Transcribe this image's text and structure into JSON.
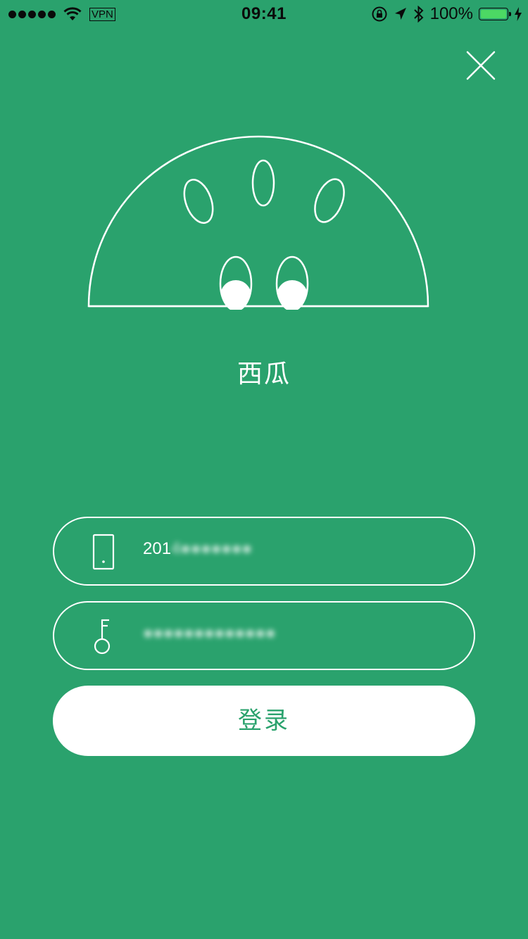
{
  "status_bar": {
    "carrier_label": "VPN",
    "time": "09:41",
    "battery_percent": "100%",
    "battery_level": 1.0,
    "battery_color": "#4cd964"
  },
  "theme": {
    "background": "#2aa26d",
    "foreground": "#ffffff"
  },
  "header": {
    "close_icon": "close-icon"
  },
  "logo": {
    "icon": "watermelon-icon"
  },
  "app": {
    "name": "西瓜"
  },
  "form": {
    "phone": {
      "icon": "phone-icon",
      "value_visible": "201",
      "value_blurred": "4●●●●●●●"
    },
    "password": {
      "icon": "key-icon",
      "value_blurred": "●●●●●●●●●●●●●"
    },
    "login_label": "登录"
  }
}
